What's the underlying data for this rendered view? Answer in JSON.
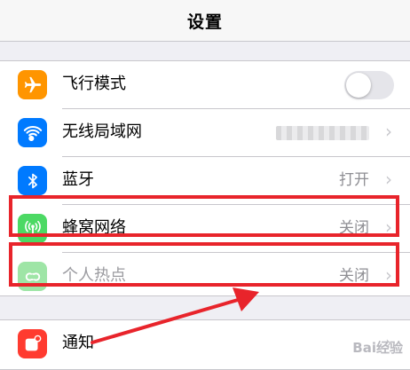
{
  "header": {
    "title": "设置"
  },
  "settings": {
    "airplane": {
      "label": "飞行模式",
      "toggle_on": false,
      "icon": "airplane-icon",
      "color": "#ff9500"
    },
    "wifi": {
      "label": "无线局域网",
      "value": "",
      "icon": "wifi-icon",
      "color": "#007aff"
    },
    "bluetooth": {
      "label": "蓝牙",
      "value": "打开",
      "icon": "bluetooth-icon",
      "color": "#007aff"
    },
    "cellular": {
      "label": "蜂窝网络",
      "value": "关闭",
      "icon": "cellular-antenna-icon",
      "color": "#4cd964"
    },
    "hotspot": {
      "label": "个人热点",
      "value": "关闭",
      "icon": "hotspot-link-icon",
      "color": "#9ee5a6"
    },
    "notifications": {
      "label": "通知",
      "icon": "notifications-icon",
      "color": "#ff3b30"
    }
  },
  "chevron": "›",
  "annotation_color": "#e8242b",
  "watermark": "Bai经验"
}
